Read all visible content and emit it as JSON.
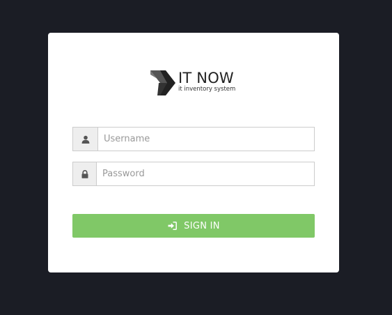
{
  "brand": {
    "name": "IT NOW",
    "tagline": "it inventory system",
    "logo_icon": "it-now-logo-mark"
  },
  "login": {
    "username": {
      "icon": "user-icon",
      "placeholder": "Username",
      "value": ""
    },
    "password": {
      "icon": "lock-icon",
      "placeholder": "Password",
      "value": ""
    },
    "submit": {
      "icon": "sign-in-icon",
      "label": "SIGN IN"
    }
  },
  "colors": {
    "page_background": "#1b1d25",
    "card_background": "#ffffff",
    "button_green": "#80c867",
    "addon_background": "#eeeeee",
    "border": "#cccccc"
  }
}
